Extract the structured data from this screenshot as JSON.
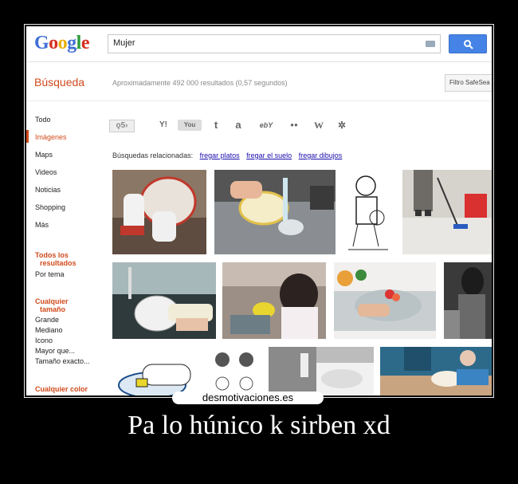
{
  "google": {
    "logo_letters": [
      {
        "ch": "G",
        "color": "#3f6fd6"
      },
      {
        "ch": "o",
        "color": "#d62d20"
      },
      {
        "ch": "o",
        "color": "#e8b000"
      },
      {
        "ch": "g",
        "color": "#3f6fd6"
      },
      {
        "ch": "l",
        "color": "#2b9c3b"
      },
      {
        "ch": "e",
        "color": "#d62d20"
      }
    ],
    "search_value": "Mujer",
    "section_title": "Búsqueda",
    "stats": "Aproximadamente 492 000 resultados (0,57 segundos)",
    "filter_label": "Filtro SafeSea",
    "nav": {
      "items": [
        "Todo",
        "Imágenes",
        "Maps",
        "Videos",
        "Noticias",
        "Shopping",
        "Más"
      ],
      "active": "Imágenes"
    },
    "filters": {
      "results_head_1": "Todos los",
      "results_head_2": "resultados",
      "por_tema": "Por tema",
      "size_head_1": "Cualquier",
      "size_head_2": "tamaño",
      "sizes": [
        "Grande",
        "Mediano",
        "Icono",
        "Mayor que...",
        "Tamaño exacto..."
      ],
      "color_head": "Cualquier color"
    },
    "toolbar_icons": [
      "ask-icon",
      "yahoo-icon",
      "youtube-icon",
      "tumblr-icon",
      "amazon-icon",
      "ebay-icon",
      "flickr-icon",
      "wikipedia-icon",
      "delicious-icon"
    ],
    "toolbar_text": [
      "Y!",
      "You",
      "t",
      "a",
      "ebY",
      "●●",
      "W",
      "✲"
    ],
    "related_label": "Búsquedas relacionadas:",
    "related_links": [
      "fregar platos",
      "fregar el suelo",
      "fregar dibujos"
    ]
  },
  "watermark": "desmotivaciones.es",
  "caption": "Pa lo húnico k sirben xd",
  "colors": {
    "accent": "#d04a1c",
    "link": "#1a0dab",
    "search_button": "#4584e6"
  }
}
